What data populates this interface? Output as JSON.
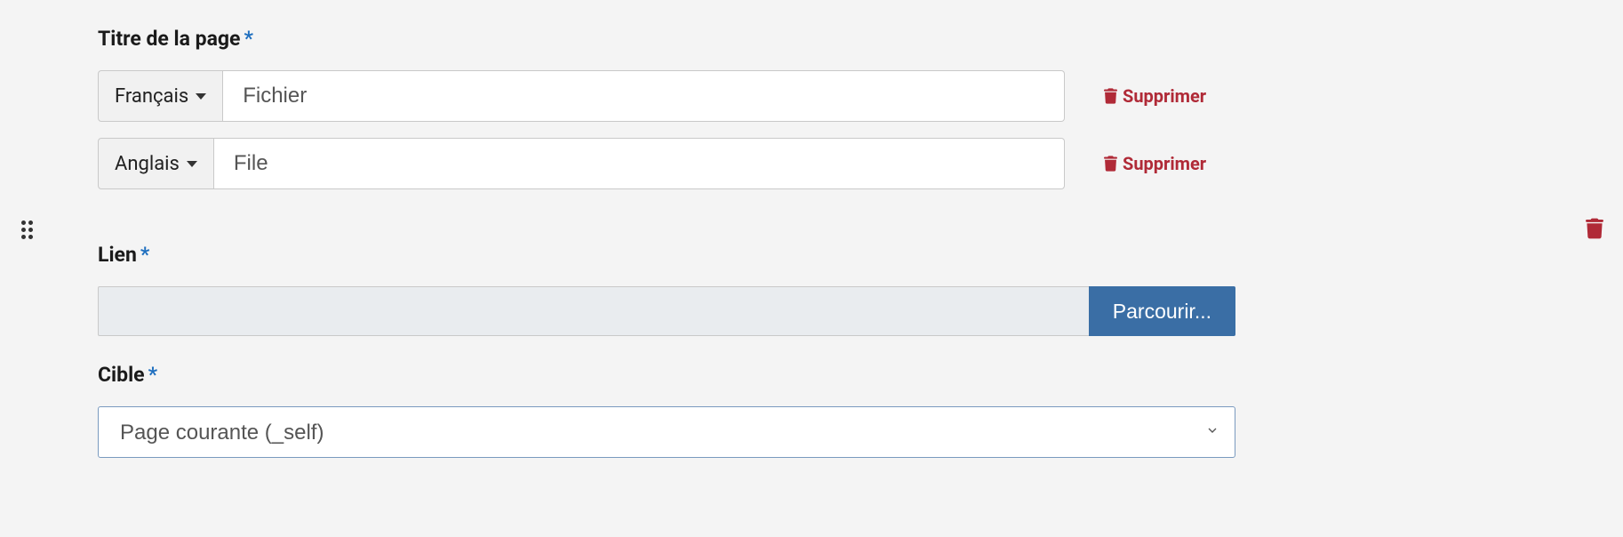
{
  "title_field": {
    "label": "Titre de la page",
    "rows": [
      {
        "language": "Français",
        "value": "Fichier",
        "delete_label": "Supprimer"
      },
      {
        "language": "Anglais",
        "value": "File",
        "delete_label": "Supprimer"
      }
    ]
  },
  "link_field": {
    "label": "Lien",
    "value": "",
    "browse_label": "Parcourir..."
  },
  "target_field": {
    "label": "Cible",
    "selected": "Page courante (_self)"
  }
}
